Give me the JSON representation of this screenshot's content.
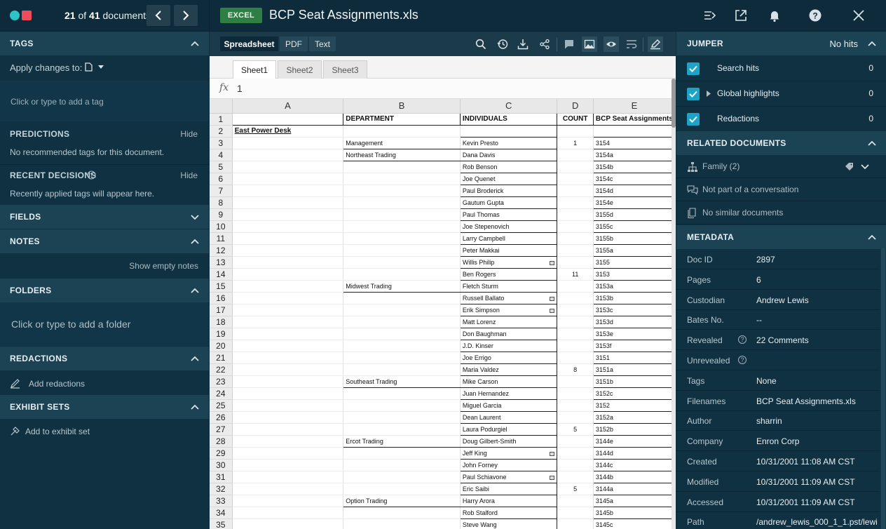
{
  "topbar": {
    "doc_position": "21",
    "doc_of": "of",
    "doc_total": "41",
    "doc_word": "documents",
    "file_type": "EXCEL",
    "title": "BCP Seat Assignments.xls",
    "icons": [
      "export-icon",
      "open-external-icon",
      "bell-icon",
      "help-icon",
      "close-icon"
    ]
  },
  "left": {
    "tags": {
      "title": "TAGS",
      "apply_label": "Apply changes to:",
      "placeholder": "Click or type to add a tag"
    },
    "predictions": {
      "title": "PREDICTIONS",
      "hide": "Hide",
      "text": "No recommended tags for this document."
    },
    "recent": {
      "title": "RECENT DECISIONS",
      "hide": "Hide",
      "text": "Recently applied tags will appear here."
    },
    "fields": {
      "title": "FIELDS"
    },
    "notes": {
      "title": "NOTES",
      "show_empty": "Show empty notes"
    },
    "folders": {
      "title": "FOLDERS",
      "placeholder": "Click or type to add a folder"
    },
    "redactions": {
      "title": "REDACTIONS",
      "add": "Add redactions"
    },
    "exhibits": {
      "title": "EXHIBIT SETS",
      "add": "Add to exhibit set"
    }
  },
  "viewer": {
    "tabs": [
      "Spreadsheet",
      "PDF",
      "Text"
    ],
    "active_tab": "Spreadsheet",
    "sheets": [
      "Sheet1",
      "Sheet2",
      "Sheet3"
    ],
    "active_sheet": "Sheet1",
    "fx_label": "fx",
    "fx_value": "1",
    "columns": [
      "A",
      "B",
      "C",
      "D",
      "E"
    ],
    "rows": [
      {
        "n": "1",
        "a": "",
        "b": "DEPARTMENT",
        "c": "INDIVIDUALS",
        "d": "COUNT",
        "e": "BCP Seat Assignments"
      },
      {
        "n": "2",
        "a": "East Power Desk",
        "b": "",
        "c": "",
        "d": "",
        "e": ""
      },
      {
        "n": "3",
        "a": "",
        "b": "Management",
        "c": "Kevin Presto",
        "d": "1",
        "e": "3154"
      },
      {
        "n": "4",
        "a": "",
        "b": "Northeast Trading",
        "c": "Dana Davis",
        "d": "",
        "e": "3154a"
      },
      {
        "n": "5",
        "a": "",
        "b": "",
        "c": "Rob Benson",
        "d": "",
        "e": "3154b"
      },
      {
        "n": "6",
        "a": "",
        "b": "",
        "c": "Joe Quenet",
        "d": "",
        "e": "3154c"
      },
      {
        "n": "7",
        "a": "",
        "b": "",
        "c": "Paul Broderick",
        "d": "",
        "e": "3154d"
      },
      {
        "n": "8",
        "a": "",
        "b": "",
        "c": "Gautum Gupta",
        "d": "",
        "e": "3154e"
      },
      {
        "n": "9",
        "a": "",
        "b": "",
        "c": "Paul Thomas",
        "d": "",
        "e": "3155d"
      },
      {
        "n": "10",
        "a": "",
        "b": "",
        "c": "Joe Stepenovich",
        "d": "",
        "e": "3155c"
      },
      {
        "n": "11",
        "a": "",
        "b": "",
        "c": "Larry Campbell",
        "d": "",
        "e": "3155b"
      },
      {
        "n": "12",
        "a": "",
        "b": "",
        "c": "Peter Makkai",
        "d": "",
        "e": "3155a"
      },
      {
        "n": "13",
        "a": "",
        "b": "",
        "c": "Willis Philip",
        "d": "",
        "e": "3155",
        "cm": true
      },
      {
        "n": "14",
        "a": "",
        "b": "",
        "c": "Ben Rogers",
        "d": "11",
        "e": "3153"
      },
      {
        "n": "15",
        "a": "",
        "b": "Midwest Trading",
        "c": "Fletch Sturm",
        "d": "",
        "e": "3153a"
      },
      {
        "n": "16",
        "a": "",
        "b": "",
        "c": "Russell Ballato",
        "d": "",
        "e": "3153b",
        "cm": true
      },
      {
        "n": "17",
        "a": "",
        "b": "",
        "c": "Erik Simpson",
        "d": "",
        "e": "3153c",
        "cm": true
      },
      {
        "n": "18",
        "a": "",
        "b": "",
        "c": "Matt Lorenz",
        "d": "",
        "e": "3153d"
      },
      {
        "n": "19",
        "a": "",
        "b": "",
        "c": "Don Baughman",
        "d": "",
        "e": "3153e"
      },
      {
        "n": "20",
        "a": "",
        "b": "",
        "c": "J.D. Kinser",
        "d": "",
        "e": "3153f"
      },
      {
        "n": "21",
        "a": "",
        "b": "",
        "c": "Joe Errigo",
        "d": "",
        "e": "3151"
      },
      {
        "n": "22",
        "a": "",
        "b": "",
        "c": "Maria Valdez",
        "d": "8",
        "e": "3151a"
      },
      {
        "n": "23",
        "a": "",
        "b": "Southeast Trading",
        "c": "Mike Carson",
        "d": "",
        "e": "3151b"
      },
      {
        "n": "24",
        "a": "",
        "b": "",
        "c": "Juan Hernandez",
        "d": "",
        "e": "3152c"
      },
      {
        "n": "25",
        "a": "",
        "b": "",
        "c": "Miguel Garcia",
        "d": "",
        "e": "3152"
      },
      {
        "n": "26",
        "a": "",
        "b": "",
        "c": "Dean Laurent",
        "d": "",
        "e": "3152a"
      },
      {
        "n": "27",
        "a": "",
        "b": "",
        "c": "Laura Podurgiel",
        "d": "5",
        "e": "3152b"
      },
      {
        "n": "28",
        "a": "",
        "b": "Ercot Trading",
        "c": "Doug Gilbert-Smith",
        "d": "",
        "e": "3144e"
      },
      {
        "n": "29",
        "a": "",
        "b": "",
        "c": "Jeff King",
        "d": "",
        "e": "3144d",
        "cm": true
      },
      {
        "n": "30",
        "a": "",
        "b": "",
        "c": "John Forney",
        "d": "",
        "e": "3144c"
      },
      {
        "n": "31",
        "a": "",
        "b": "",
        "c": "Paul Schiavone",
        "d": "",
        "e": "3144b",
        "cm": true
      },
      {
        "n": "32",
        "a": "",
        "b": "",
        "c": "Eric Saibi",
        "d": "5",
        "e": "3144a"
      },
      {
        "n": "33",
        "a": "",
        "b": "Option Trading",
        "c": "Harry Arora",
        "d": "",
        "e": "3145a"
      },
      {
        "n": "34",
        "a": "",
        "b": "",
        "c": "Rob Stalford",
        "d": "",
        "e": "3145b"
      },
      {
        "n": "35",
        "a": "",
        "b": "",
        "c": "Steve Wang",
        "d": "",
        "e": "3145c"
      }
    ]
  },
  "right": {
    "jumper": {
      "title": "JUMPER",
      "status": "No hits",
      "items": [
        {
          "label": "Search hits",
          "count": "0"
        },
        {
          "label": "Global highlights",
          "count": "0"
        },
        {
          "label": "Redactions",
          "count": "0"
        }
      ]
    },
    "related": {
      "title": "RELATED DOCUMENTS",
      "family": "Family (2)",
      "conversation": "Not part of a conversation",
      "similar": "No similar documents"
    },
    "metadata": {
      "title": "METADATA",
      "rows": [
        {
          "k": "Doc ID",
          "v": "2897"
        },
        {
          "k": "Pages",
          "v": "6"
        },
        {
          "k": "Custodian",
          "v": "Andrew Lewis"
        },
        {
          "k": "Bates No.",
          "v": "--"
        },
        {
          "k": "Revealed",
          "v": "22 Comments",
          "help": true
        },
        {
          "k": "Unrevealed",
          "v": "",
          "help": true
        },
        {
          "k": "Tags",
          "v": "None"
        },
        {
          "k": "Filenames",
          "v": "BCP Seat Assignments.xls"
        },
        {
          "k": "Author",
          "v": "sharrin"
        },
        {
          "k": "Company",
          "v": "Enron Corp"
        },
        {
          "k": "Created",
          "v": "10/31/2001 11:08 AM CST"
        },
        {
          "k": "Modified",
          "v": "10/31/2001 11:09 AM CST"
        },
        {
          "k": "Accessed",
          "v": "10/31/2001 11:09 AM CST"
        },
        {
          "k": "Path",
          "v": "/andrew_lewis_000_1_1.pst/lewi"
        }
      ]
    }
  }
}
